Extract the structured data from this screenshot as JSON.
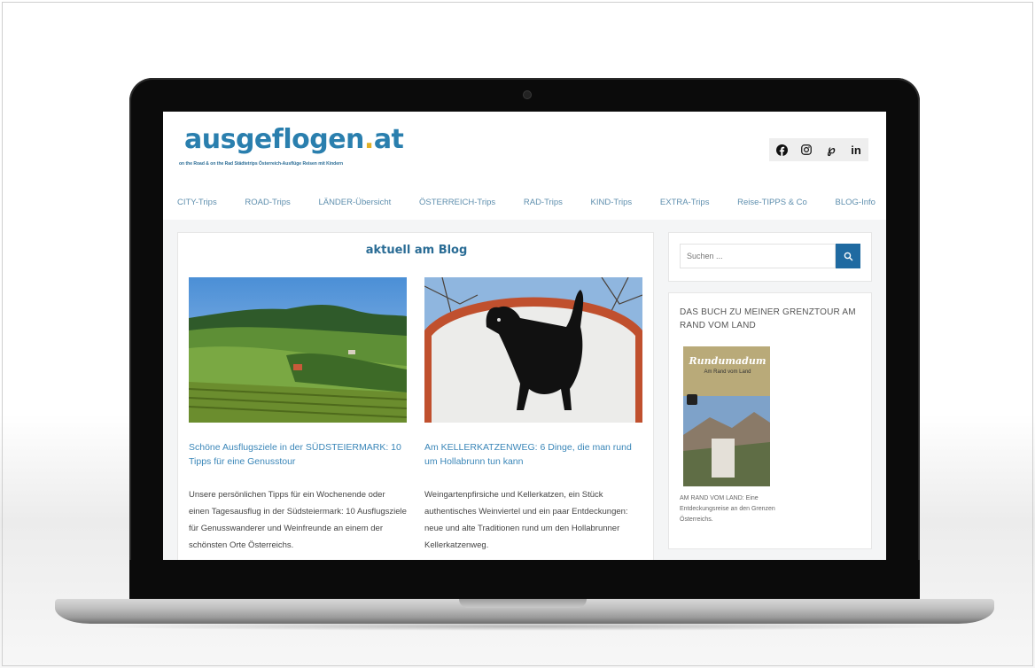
{
  "site": {
    "logo_main": "ausgeflogen",
    "logo_dot": ".",
    "logo_tld": "at",
    "tagline": "on the Road & on the Rad    Städtetrips    Österreich-Ausflüge    Reisen mit Kindern"
  },
  "social": {
    "icons": [
      "facebook-icon",
      "instagram-icon",
      "pinterest-icon",
      "linkedin-icon"
    ],
    "facebook": "f",
    "instagram": "◎",
    "pinterest": "℘",
    "linkedin": "in"
  },
  "nav": {
    "items": [
      {
        "label": "CITY-Trips"
      },
      {
        "label": "ROAD-Trips"
      },
      {
        "label": "LÄNDER-Übersicht"
      },
      {
        "label": "ÖSTERREICH-Trips"
      },
      {
        "label": "RAD-Trips"
      },
      {
        "label": "KIND-Trips"
      },
      {
        "label": "EXTRA-Trips"
      },
      {
        "label": "Reise-TIPPS & Co"
      },
      {
        "label": "BLOG-Info"
      }
    ]
  },
  "main": {
    "section_title": "aktuell am Blog",
    "posts": [
      {
        "title": "Schöne Ausflugsziele in der SÜDSTEIERMARK: 10 Tipps für eine Genusstour",
        "excerpt": "Unsere persönlichen Tipps für ein Wochenende oder einen Tagesausflug in der Südsteiermark: 10 Ausflugsziele für Genusswanderer und Weinfreunde an einem der schönsten Orte Österreichs."
      },
      {
        "title": "Am KELLERKATZENWEG: 6 Dinge, die man rund um Hollabrunn tun kann",
        "excerpt": "Weingartenpfirsiche und Kellerkatzen, ein Stück authentisches Weinviertel und ein paar Entdeckungen: neue und alte Traditionen rund um den Hollabrunner Kellerkatzenweg."
      }
    ]
  },
  "sidebar": {
    "search_placeholder": "Suchen ...",
    "book_heading": "DAS BUCH ZU MEINER GRENZTOUR AM RAND VOM LAND",
    "book_title": "Rundumadum",
    "book_subtitle": "Am Rand vom Land",
    "book_caption": "AM RAND VOM LAND: Eine Entdeckungsreise an den Grenzen Österreichs."
  },
  "colors": {
    "accent": "#2a7fae",
    "button": "#1f6aa1",
    "nav_text": "#5f8fae"
  }
}
